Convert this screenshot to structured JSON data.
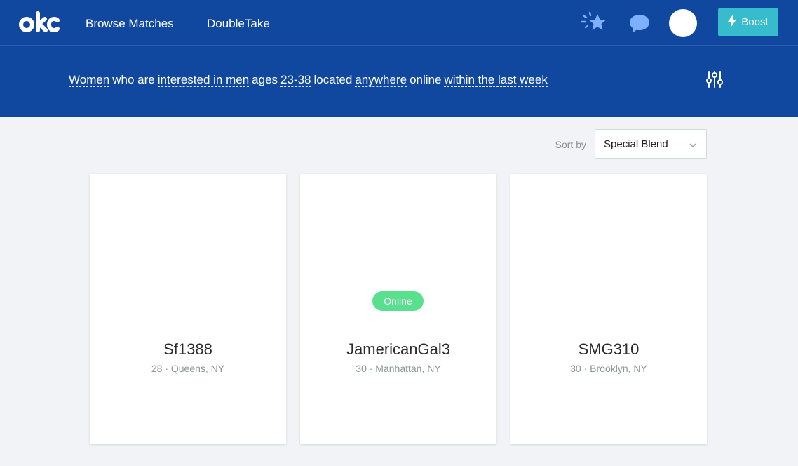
{
  "header": {
    "logo_text": "okc",
    "nav": [
      {
        "label": "Browse Matches"
      },
      {
        "label": "DoubleTake"
      }
    ],
    "icons": [
      "star-icon",
      "chat-bubble-icon",
      "lightning-icon"
    ],
    "boost_label": "Boost",
    "colors": {
      "bar": "#1048a0",
      "boost": "#36bccc",
      "online": "#59e08f"
    }
  },
  "filter": {
    "gender": "Women",
    "who_are": "who are",
    "interest": "interested in men",
    "ages_word": "ages",
    "ages": "23-38",
    "located": "located",
    "location": "anywhere",
    "online_word": "online",
    "activity": "within the last week"
  },
  "sort": {
    "label": "Sort by",
    "value": "Special Blend"
  },
  "cards": [
    {
      "name": "Sf1388",
      "meta": "28 · Queens, NY"
    },
    {
      "name": "JamericanGal3",
      "meta": "30 · Manhattan, NY",
      "badge": "Online"
    },
    {
      "name": "SMG310",
      "meta": "30 · Brooklyn, NY"
    }
  ]
}
